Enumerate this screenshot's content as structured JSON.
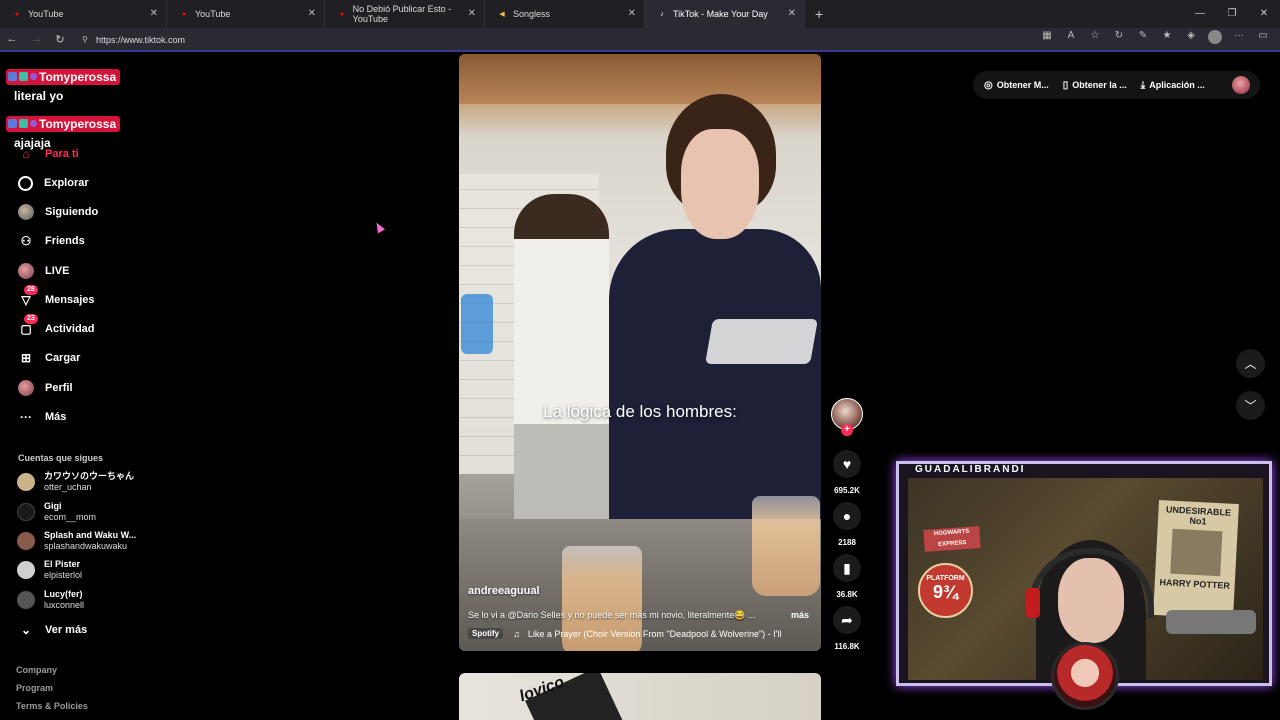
{
  "browser": {
    "tabs": [
      {
        "title": "YouTube",
        "icon": "youtube-icon",
        "color": "#ff0000"
      },
      {
        "title": "YouTube",
        "icon": "youtube-icon",
        "color": "#ff0000"
      },
      {
        "title": "No Debió Publicar Esto - YouTube",
        "icon": "youtube-icon",
        "color": "#ff0000"
      },
      {
        "title": "Songless",
        "icon": "songless-icon",
        "color": "#e8c14a"
      },
      {
        "title": "TikTok - Make Your Day",
        "icon": "tiktok-icon",
        "color": "#ffffff"
      }
    ],
    "new_tab": "+",
    "url": "https://www.tiktok.com"
  },
  "chat": [
    {
      "user": "Tomyperossa",
      "message": "literal yo"
    },
    {
      "user": "Tomyperossa",
      "message": "ajajaja"
    }
  ],
  "sidebar": {
    "partial_item": "Para ti",
    "items": [
      {
        "label": "Explorar",
        "icon": "compass-icon"
      },
      {
        "label": "Siguiendo",
        "icon": "following-avatar-icon"
      },
      {
        "label": "Friends",
        "icon": "friends-icon"
      },
      {
        "label": "LIVE",
        "icon": "live-avatar-icon"
      },
      {
        "label": "Mensajes",
        "icon": "messages-icon",
        "badge": "28"
      },
      {
        "label": "Actividad",
        "icon": "activity-icon",
        "badge": "23"
      },
      {
        "label": "Cargar",
        "icon": "upload-icon"
      },
      {
        "label": "Perfil",
        "icon": "profile-avatar-icon"
      },
      {
        "label": "Más",
        "icon": "more-icon"
      }
    ],
    "following_title": "Cuentas que sigues",
    "following": [
      {
        "name": "カワウソのウーちゃん",
        "username": "otter_uchan",
        "color": "#c9b48a"
      },
      {
        "name": "Gigi",
        "username": "ecom__mom",
        "color": "#1a1a1a"
      },
      {
        "name": "Splash and Waku W...",
        "username": "splashandwakuwaku",
        "color": "#8a5a4a"
      },
      {
        "name": "El Pister",
        "username": "elpisterlol",
        "color": "#d0d0d0"
      },
      {
        "name": "Lucy(fer)",
        "username": "luxconnell",
        "color": "#555555"
      }
    ],
    "see_more": "Ver más",
    "footer": [
      "Company",
      "Program",
      "Terms & Policies"
    ]
  },
  "video": {
    "overlay_text": "La lógica de los hombres:",
    "author": "andreeaguual",
    "description": "Se lo vi a @Dario Selles y no puede ser más mi novio, literalmente😂 ...",
    "more": "más",
    "music_source": "Spotify",
    "music": "Like a Prayer (Choir Version From \"Deadpool & Wolverine\") - I'll",
    "next_text": "lovico"
  },
  "actions": {
    "likes": "695.2K",
    "comments": "2188",
    "saves": "36.8K",
    "shares": "116.8K"
  },
  "top_right": {
    "coins": "Obtener M...",
    "app": "Obtener la ...",
    "download": "Aplicación ..."
  },
  "cam": {
    "label": "GUADALIBRANDI",
    "poster_title": "UNDESIRABLE",
    "poster_no": "No1",
    "poster_name": "HARRY POTTER",
    "sign_hogwarts": "HOGWARTS EXPRESS",
    "sign_platform": "PLATFORM",
    "sign_number": "9¾"
  }
}
